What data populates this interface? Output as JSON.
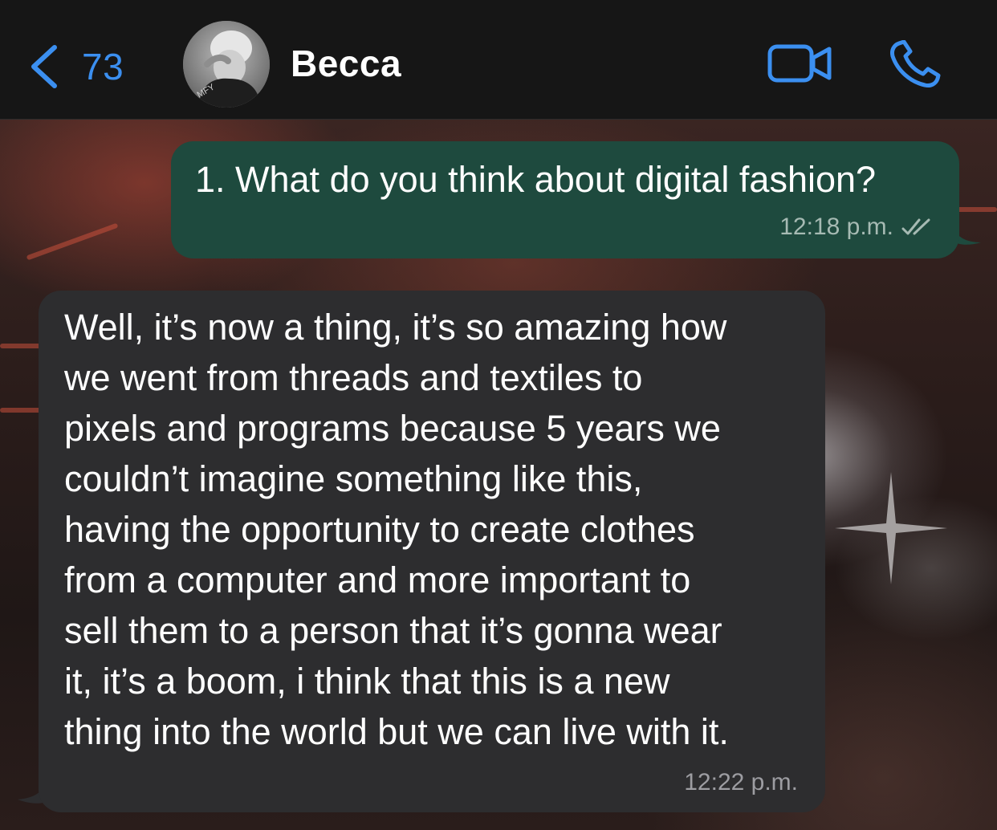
{
  "header": {
    "back_count": "73",
    "contact_name": "Becca",
    "avatar_text": "MFY",
    "icons": {
      "back": "chevron-left-icon",
      "video": "video-camera-icon",
      "phone": "phone-icon"
    },
    "accent_color": "#3b8ff0"
  },
  "messages": [
    {
      "direction": "outgoing",
      "text": "1. What do you think about digital fashion?",
      "time": "12:18 p.m.",
      "status_icon": "double-check-icon",
      "bubble_color": "#1e4a3e"
    },
    {
      "direction": "incoming",
      "lines": [
        "Well, it’s now a thing, it’s so amazing how",
        "we went from threads and textiles to",
        "pixels and programs because 5 years we",
        "couldn’t imagine something like this,",
        "having the opportunity to create clothes",
        "from a computer and more important to",
        "sell them to a person that it’s gonna wear",
        "it, it’s a boom, i think that this is a new",
        "thing into the world but we can live with it."
      ],
      "time": "12:22 p.m.",
      "bubble_color": "#2d2d2f"
    }
  ]
}
